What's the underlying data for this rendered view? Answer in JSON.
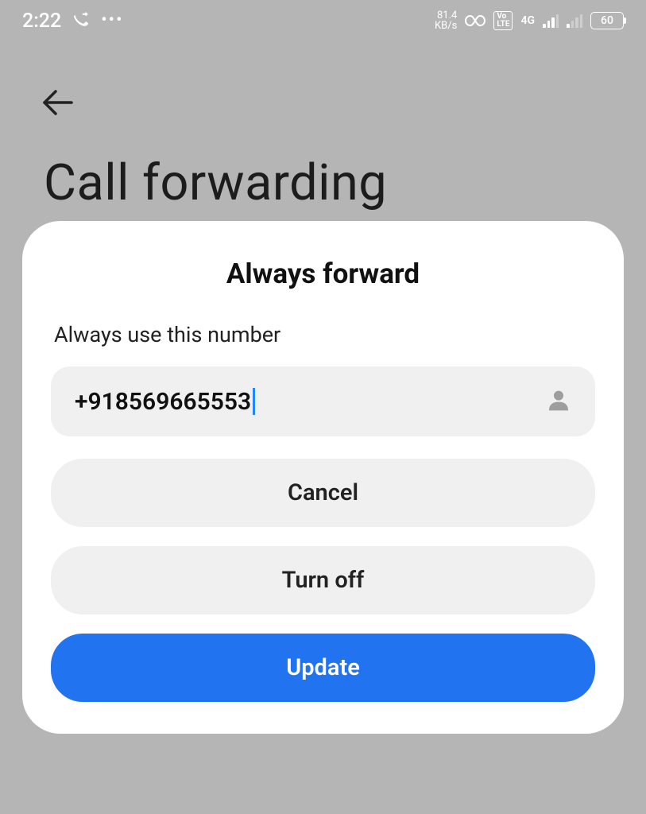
{
  "statusbar": {
    "time": "2:22",
    "data_speed_top": "81.4",
    "data_speed_bottom": "KB/s",
    "volte": "Vo\nLTE",
    "network": "4G",
    "battery": "60"
  },
  "page": {
    "title": "Call forwarding"
  },
  "modal": {
    "title": "Always forward",
    "label": "Always use this number",
    "phone": "+918569665553",
    "cancel": "Cancel",
    "turn_off": "Turn off",
    "update": "Update"
  }
}
